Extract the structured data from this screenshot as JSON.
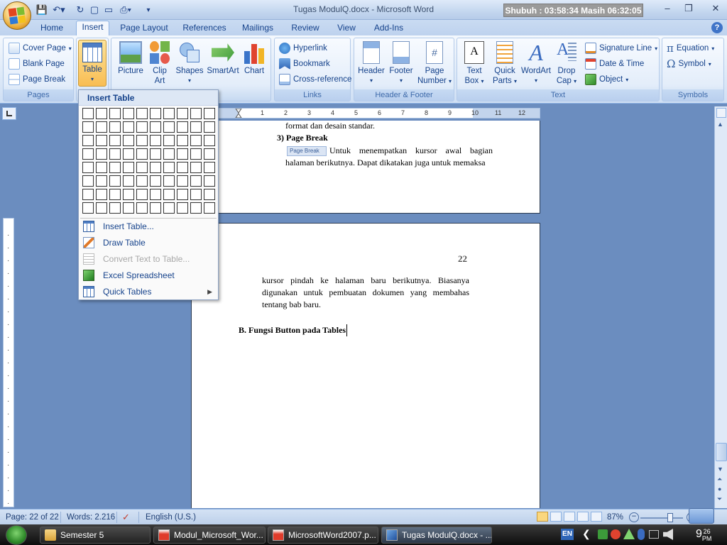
{
  "window": {
    "title": "Tugas ModulQ.docx - Microsoft Word",
    "clock_banner": "Shubuh : 03:58:34  Masih 06:32:05"
  },
  "tabs": [
    "Home",
    "Insert",
    "Page Layout",
    "References",
    "Mailings",
    "Review",
    "View",
    "Add-Ins"
  ],
  "active_tab": "Insert",
  "ribbon": {
    "pages": {
      "label": "Pages",
      "cover_page": "Cover Page",
      "blank_page": "Blank Page",
      "page_break": "Page Break"
    },
    "tables": {
      "table": "Table"
    },
    "illustrations": {
      "picture": "Picture",
      "clip_art_1": "Clip",
      "clip_art_2": "Art",
      "shapes": "Shapes",
      "smartart": "SmartArt",
      "chart": "Chart"
    },
    "links": {
      "label": "Links",
      "hyperlink": "Hyperlink",
      "bookmark": "Bookmark",
      "cross_reference": "Cross-reference"
    },
    "header_footer": {
      "label": "Header & Footer",
      "header": "Header",
      "footer": "Footer",
      "page_number_1": "Page",
      "page_number_2": "Number"
    },
    "text": {
      "label": "Text",
      "text_box_1": "Text",
      "text_box_2": "Box",
      "quick_parts_1": "Quick",
      "quick_parts_2": "Parts",
      "wordart": "WordArt",
      "drop_cap_1": "Drop",
      "drop_cap_2": "Cap",
      "signature_line": "Signature Line",
      "date_time": "Date & Time",
      "object": "Object"
    },
    "symbols": {
      "label": "Symbols",
      "equation": "Equation",
      "symbol": "Symbol"
    }
  },
  "dropdown": {
    "header": "Insert Table",
    "grid_rows": 8,
    "grid_cols": 10,
    "items": [
      {
        "label": "Insert Table...",
        "disabled": false
      },
      {
        "label": "Draw Table",
        "disabled": false
      },
      {
        "label": "Convert Text to Table...",
        "disabled": true
      },
      {
        "label": "Excel Spreadsheet",
        "disabled": false
      },
      {
        "label": "Quick Tables",
        "disabled": false
      }
    ]
  },
  "document": {
    "page1_line1": "format dan desain standar.",
    "page1_heading": "3)  Page Break",
    "page1_pagebreak_img": "Page Break",
    "page1_para": "Untuk menempatkan kursor awal bagian halaman berikutnya. Dapat dikatakan juga untuk memaksa",
    "page_number": "22",
    "page2_para": "kursor pindah ke halaman baru berikutnya. Biasanya digunakan untuk pembuatan dokumen yang membahas tentang bab baru.",
    "page2_heading": "B. Fungsi Button pada Tables"
  },
  "ruler": {
    "marks": [
      "1",
      "2",
      "3",
      "4",
      "5",
      "6",
      "7",
      "8",
      "9",
      "10",
      "11",
      "12"
    ]
  },
  "statusbar": {
    "page": "Page: 22 of 22",
    "words": "Words: 2.216",
    "language": "English (U.S.)",
    "zoom": "87%"
  },
  "taskbar": {
    "items": [
      "Semester 5",
      "Modul_Microsoft_Wor...",
      "MicrosoftWord2007.p...",
      "Tugas ModulQ.docx - ..."
    ],
    "lang": "EN",
    "time_hour": "9",
    "time_min": "26",
    "time_ampm": "PM"
  }
}
